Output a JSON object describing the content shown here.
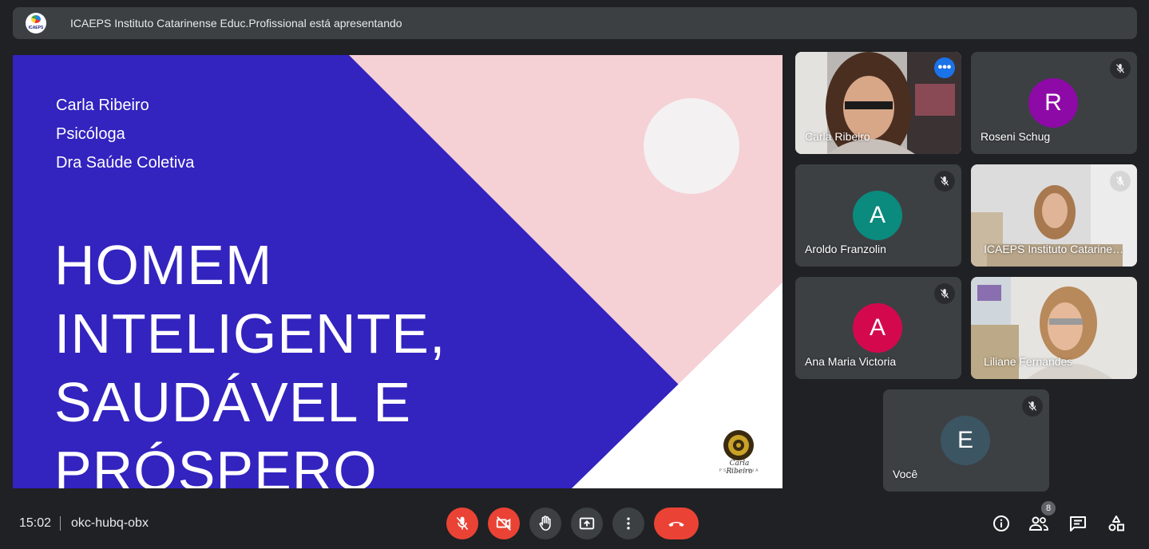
{
  "banner": {
    "presenter_text": "ICAEPS Instituto Catarinense Educ.Profissional está apresentando",
    "logo_label": "ICAEPS"
  },
  "slide": {
    "author_name": "Carla Ribeiro",
    "author_role": "Psicóloga",
    "author_degree": "Dra Saúde Coletiva",
    "title_lines": [
      "HOMEM",
      "INTELIGENTE,",
      "SAUDÁVEL E",
      "PRÓSPERO"
    ],
    "logo_signature": "Carla Ribeiro",
    "logo_subtitle": "PSICOLOGIA",
    "colors": {
      "blue": "#3323bf",
      "pink": "#f5d0d5",
      "white": "#ffffff"
    }
  },
  "participants": [
    {
      "name": "Carla Ribeiro",
      "type": "video",
      "active": true,
      "icon": "more-options-icon"
    },
    {
      "name": "Roseni Schug",
      "initial": "R",
      "avatar_color": "#8e0aa6",
      "muted": true
    },
    {
      "name": "Aroldo Franzolin",
      "initial": "A",
      "avatar_color": "#0b8a7e",
      "muted": true
    },
    {
      "name": "ICAEPS Instituto Catarinense Educ.Profissional",
      "type": "video",
      "muted": true
    },
    {
      "name": "Ana Maria Victoria",
      "initial": "A",
      "avatar_color": "#d4094d",
      "muted": true
    },
    {
      "name": "Liliane Fernandes",
      "type": "video"
    },
    {
      "name": "Você",
      "initial": "E",
      "avatar_color": "#3c5563",
      "muted": true
    }
  ],
  "bottom_bar": {
    "time": "15:02",
    "meeting_code": "okc-hubq-obx",
    "participant_count": "8",
    "controls": [
      "mic-off-icon",
      "camera-off-icon",
      "raise-hand-icon",
      "present-icon",
      "more-vert-icon",
      "hang-up-icon"
    ],
    "right_icons": [
      "info-icon",
      "people-icon",
      "chat-icon",
      "activities-icon"
    ],
    "colors": {
      "danger": "#ea4335",
      "control_bg": "#3c4043"
    }
  }
}
